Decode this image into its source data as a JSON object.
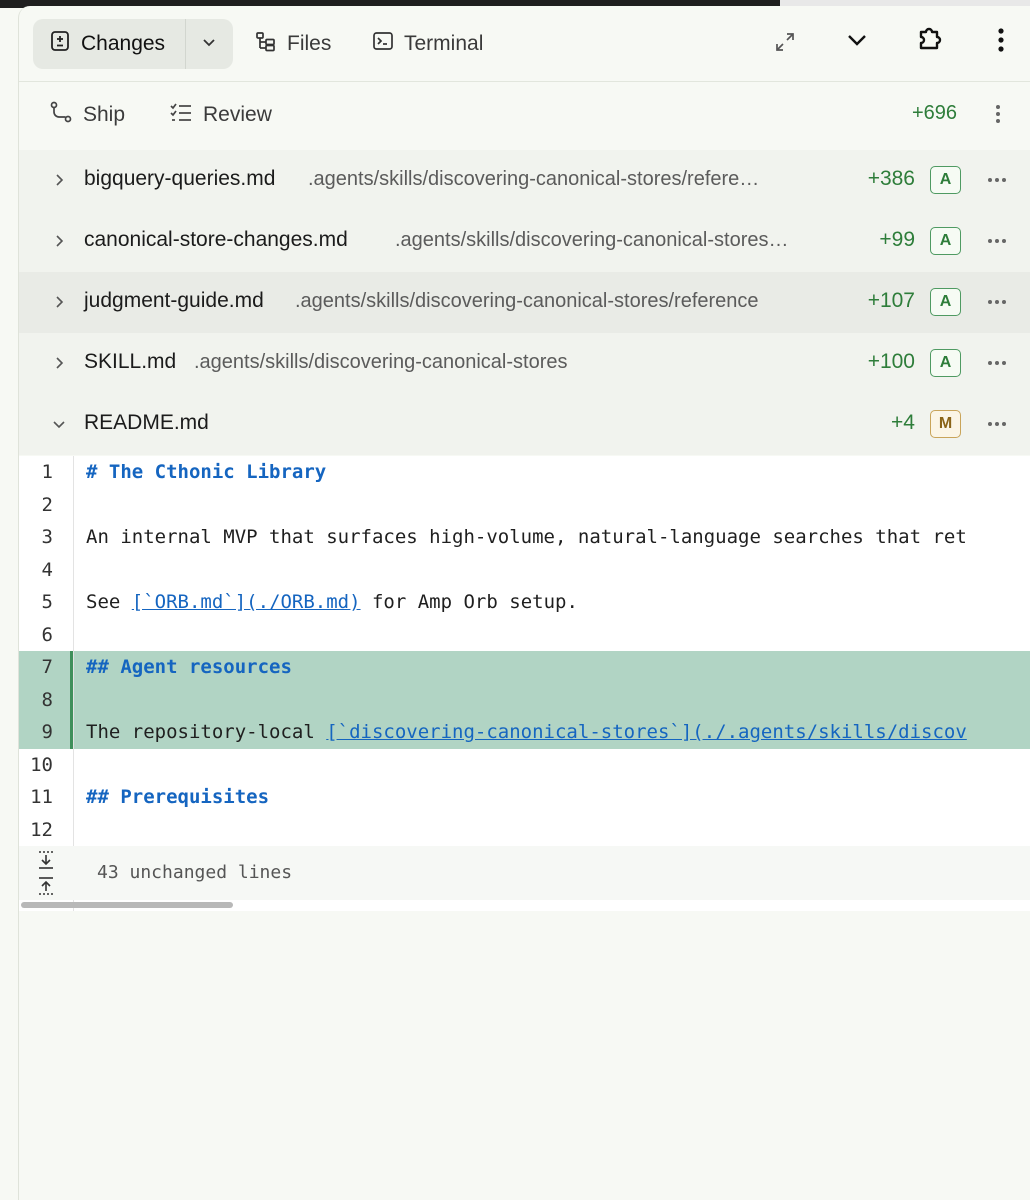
{
  "toolbar": {
    "tabs": [
      {
        "label": "Changes",
        "active": true
      },
      {
        "label": "Files",
        "active": false
      },
      {
        "label": "Terminal",
        "active": false
      }
    ]
  },
  "subbar": {
    "ship_label": "Ship",
    "review_label": "Review",
    "total_additions": "+696"
  },
  "files": [
    {
      "name": "bigquery-queries.md",
      "path": ".agents/skills/discovering-canonical-stores/refere…",
      "additions": "+386",
      "status": "A"
    },
    {
      "name": "canonical-store-changes.md",
      "path": ".agents/skills/discovering-canonical-stores…",
      "additions": "+99",
      "status": "A"
    },
    {
      "name": "judgment-guide.md",
      "path": ".agents/skills/discovering-canonical-stores/reference",
      "additions": "+107",
      "status": "A"
    },
    {
      "name": "SKILL.md",
      "path": ".agents/skills/discovering-canonical-stores",
      "additions": "+100",
      "status": "A"
    },
    {
      "name": "README.md",
      "path": "",
      "additions": "+4",
      "status": "M"
    }
  ],
  "code": {
    "lines": [
      {
        "n": "1",
        "parts": [
          {
            "t": "# The Cthonic Library",
            "c": "heading"
          }
        ]
      },
      {
        "n": "2",
        "parts": []
      },
      {
        "n": "3",
        "parts": [
          {
            "t": "An internal MVP that surfaces high-volume, natural-language searches that ret",
            "c": ""
          }
        ]
      },
      {
        "n": "4",
        "parts": []
      },
      {
        "n": "5",
        "parts": [
          {
            "t": "See ",
            "c": ""
          },
          {
            "t": "[`ORB.md`](./ORB.md)",
            "c": "link"
          },
          {
            "t": " for Amp Orb setup.",
            "c": ""
          }
        ]
      },
      {
        "n": "6",
        "parts": []
      },
      {
        "n": "7",
        "parts": [
          {
            "t": "## Agent resources",
            "c": "heading"
          }
        ],
        "added": true
      },
      {
        "n": "8",
        "parts": [],
        "added": true
      },
      {
        "n": "9",
        "parts": [
          {
            "t": "The repository-local ",
            "c": ""
          },
          {
            "t": "[`discovering-canonical-stores`](./.agents/skills/discov",
            "c": "link"
          }
        ],
        "added": true
      },
      {
        "n": "10",
        "parts": []
      },
      {
        "n": "11",
        "parts": [
          {
            "t": "## Prerequisites",
            "c": "heading"
          }
        ]
      },
      {
        "n": "12",
        "parts": []
      }
    ],
    "unchanged_label": "43 unchanged lines"
  },
  "colors": {
    "added_bg": "#b1d4c4",
    "added_bar": "#3f8f5b",
    "additions_text": "#2e7d3a",
    "link": "#1565c0",
    "modified_badge": "#c9a45a"
  }
}
